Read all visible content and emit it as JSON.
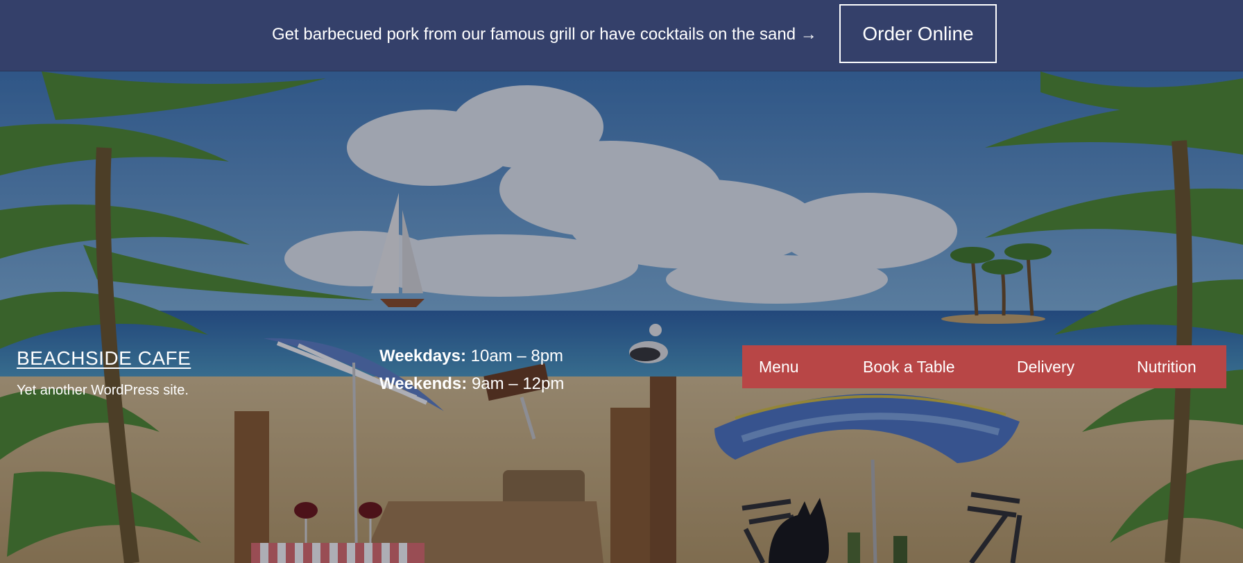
{
  "topbar": {
    "message": "Get barbecued pork from our famous grill or have cocktails on the sand →",
    "order_button": "Order Online"
  },
  "site": {
    "title": "BEACHSIDE CAFE",
    "tagline": "Yet another WordPress site."
  },
  "hours": {
    "weekdays_label": "Weekdays:",
    "weekdays_value": "10am – 8pm",
    "weekends_label": "Weekends:",
    "weekends_value": "9am – 12pm"
  },
  "nav": {
    "items": [
      {
        "label": "Menu"
      },
      {
        "label": "Book a Table"
      },
      {
        "label": "Delivery"
      },
      {
        "label": "Nutrition"
      }
    ]
  },
  "colors": {
    "topbar": "#34406a",
    "nav_background": "#b84646"
  }
}
